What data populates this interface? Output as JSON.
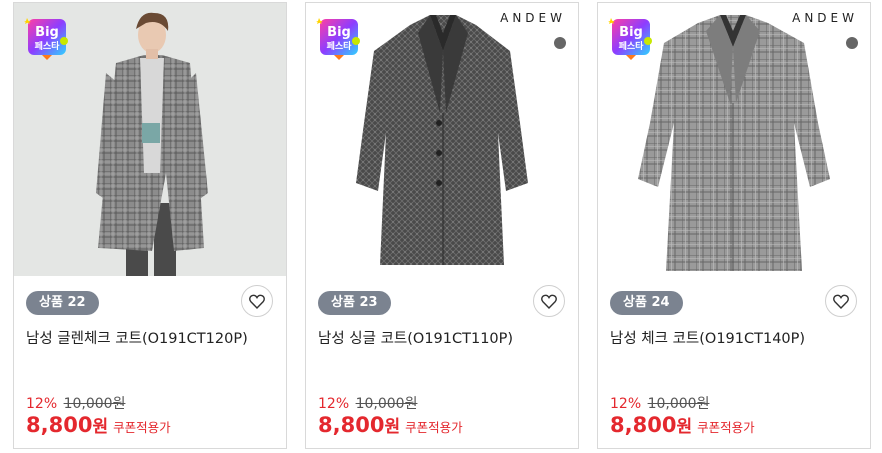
{
  "badge_text": [
    "Big",
    "페스타"
  ],
  "products": [
    {
      "tag": "상품 22",
      "name": "남성 글렌체크 코트(O191CT120P)",
      "discount": "12%",
      "original_price": "10,000원",
      "price": "8,800",
      "currency": "원",
      "coupon_label": "쿠폰적용가",
      "brand": ""
    },
    {
      "tag": "상품 23",
      "name": "남성 싱글 코트(O191CT110P)",
      "discount": "12%",
      "original_price": "10,000원",
      "price": "8,800",
      "currency": "원",
      "coupon_label": "쿠폰적용가",
      "brand": "ANDEW"
    },
    {
      "tag": "상품 24",
      "name": "남성 체크 코트(O191CT140P)",
      "discount": "12%",
      "original_price": "10,000원",
      "price": "8,800",
      "currency": "원",
      "coupon_label": "쿠폰적용가",
      "brand": "ANDEW"
    }
  ],
  "colors": {
    "accent": "#e4282e",
    "tag_bg": "#7b8390",
    "swatch": "#666666"
  }
}
